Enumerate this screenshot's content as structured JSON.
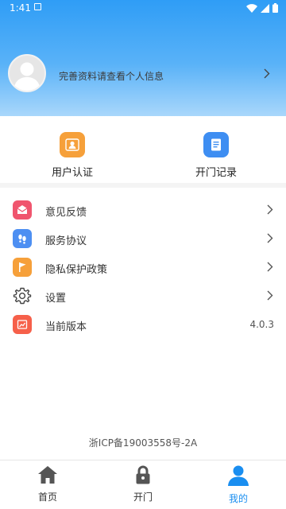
{
  "status": {
    "time": "1:41"
  },
  "profile": {
    "prompt": "完善资料请查看个人信息"
  },
  "quick_actions": [
    {
      "label": "用户认证",
      "icon": "user-id-icon",
      "color": "#f6a03a"
    },
    {
      "label": "开门记录",
      "icon": "document-icon",
      "color": "#3e8ef2"
    }
  ],
  "menu": [
    {
      "label": "意见反馈",
      "icon": "feedback-mail-icon",
      "color": "#f0556e",
      "chevron": true
    },
    {
      "label": "服务协议",
      "icon": "footprints-icon",
      "color": "#4d8ff2",
      "chevron": true
    },
    {
      "label": "隐私保护政策",
      "icon": "flag-icon",
      "color": "#f6a03a",
      "chevron": true
    },
    {
      "label": "设置",
      "icon": "gear-icon",
      "color": "#444444",
      "chevron": true
    },
    {
      "label": "当前版本",
      "icon": "chart-icon",
      "color": "#f6604a",
      "value": "4.0.3"
    }
  ],
  "footer": {
    "icp": "浙ICP备19003558号-2A"
  },
  "tabs": [
    {
      "label": "首页",
      "icon": "home-icon"
    },
    {
      "label": "开门",
      "icon": "lock-icon"
    },
    {
      "label": "我的",
      "icon": "person-icon",
      "active": true
    }
  ],
  "colors": {
    "accent": "#1a8ef0",
    "header_top": "#2f9df6",
    "header_bottom": "#a9d7fb"
  }
}
